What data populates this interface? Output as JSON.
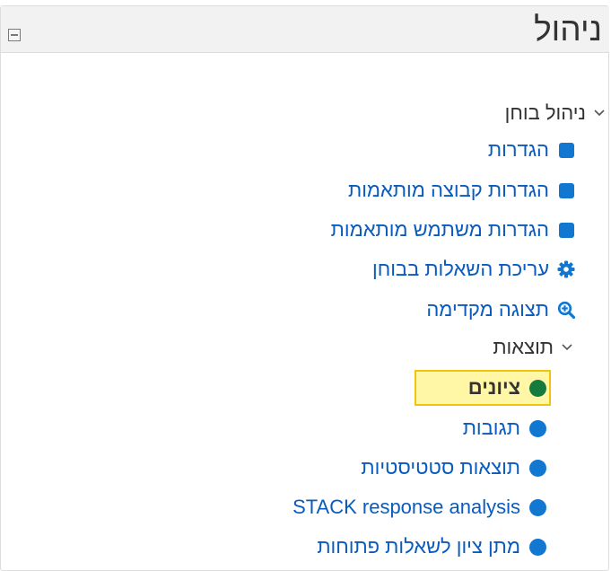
{
  "block": {
    "title": "ניהול",
    "collapse_icon": "minus-square-icon"
  },
  "tree": {
    "quiz_admin": "ניהול בוחן",
    "items": [
      {
        "label": "הגדרות",
        "icon": "square-icon"
      },
      {
        "label": "הגדרות קבוצה מותאמות",
        "icon": "square-icon"
      },
      {
        "label": "הגדרות משתמש מותאמות",
        "icon": "square-icon"
      },
      {
        "label": "עריכת השאלות בבוחן",
        "icon": "gear-icon"
      },
      {
        "label": "תצוגה מקדימה",
        "icon": "zoom-in-icon"
      }
    ],
    "results": "תוצאות",
    "result_items": [
      {
        "label": "ציונים",
        "icon": "circle-icon",
        "active": true
      },
      {
        "label": "תגובות",
        "icon": "circle-icon"
      },
      {
        "label": "תוצאות סטטיסטיות",
        "icon": "circle-icon"
      },
      {
        "label": "STACK response analysis",
        "icon": "circle-icon"
      },
      {
        "label": "מתן ציון לשאלות פתוחות",
        "icon": "circle-icon"
      }
    ]
  },
  "colors": {
    "link": "#0a5bbd",
    "icon_blue": "#1177d1",
    "active_green": "#157a3e",
    "highlight_bg": "#fff7a6",
    "highlight_border": "#f1c40f"
  }
}
